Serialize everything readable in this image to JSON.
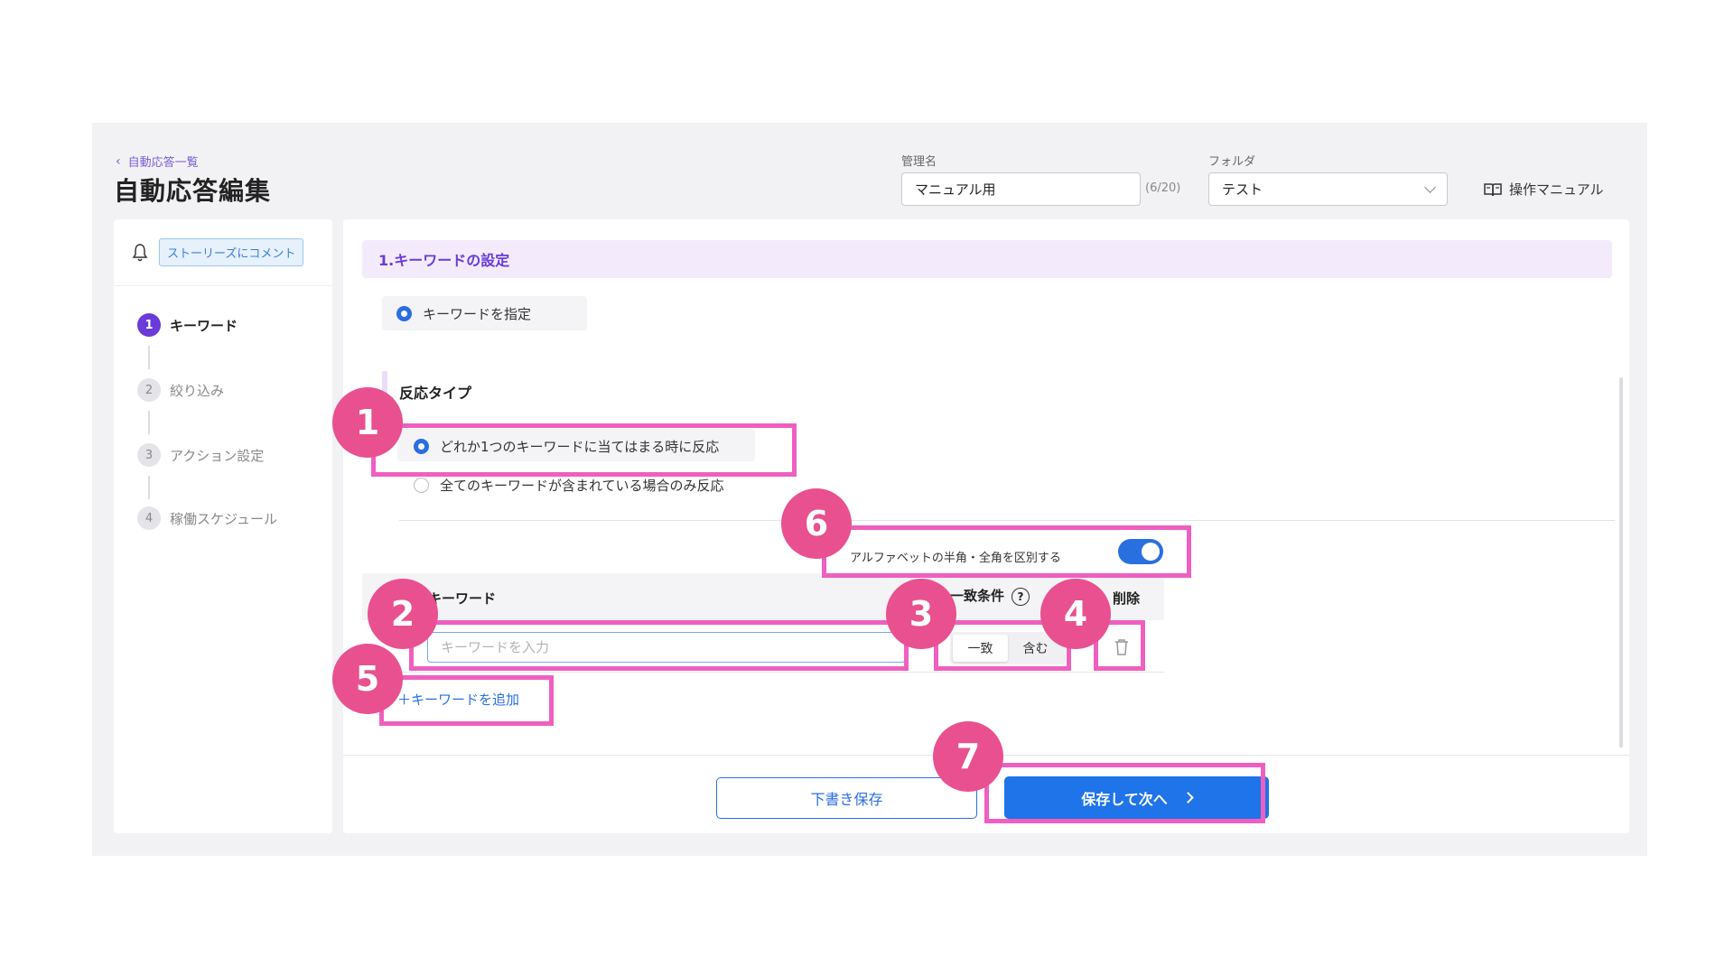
{
  "header": {
    "back_label": "自動応答一覧",
    "title": "自動応答編集",
    "name_label": "管理名",
    "name_value": "マニュアル用",
    "name_counter": "(6/20)",
    "folder_label": "フォルダ",
    "folder_value": "テスト",
    "manual_label": "操作マニュアル"
  },
  "sidebar": {
    "type_chip": "ストーリーズにコメント",
    "steps": [
      {
        "num": "1",
        "label": "キーワード"
      },
      {
        "num": "2",
        "label": "絞り込み"
      },
      {
        "num": "3",
        "label": "アクション設定"
      },
      {
        "num": "4",
        "label": "稼働スケジュール"
      }
    ]
  },
  "main": {
    "section_title": "1.キーワードの設定",
    "keyword_mode_label": "キーワードを指定",
    "reaction_type_heading": "反応タイプ",
    "reaction_options": [
      "どれか1つのキーワードに当てはまる時に反応",
      "全てのキーワードが含まれている場合のみ反応"
    ],
    "case_sensitive_label": "アルファベットの半角・全角を区別する",
    "case_sensitive_on": true,
    "table": {
      "col_keyword": "キーワード",
      "col_match": "一致条件",
      "col_delete": "削除",
      "keyword_placeholder": "キーワードを入力",
      "match_options": [
        "一致",
        "含む"
      ],
      "match_selected": "一致"
    },
    "add_keyword_label": "＋キーワードを追加",
    "draft_button": "下書き保存",
    "next_button": "保存して次へ"
  },
  "annotations": [
    "1",
    "2",
    "3",
    "4",
    "5",
    "6",
    "7"
  ],
  "colors": {
    "accent_purple": "#6a3bd8",
    "primary_blue": "#1e74e8",
    "highlight_pink": "#ef5fc0",
    "badge_pink": "#e9508f"
  }
}
